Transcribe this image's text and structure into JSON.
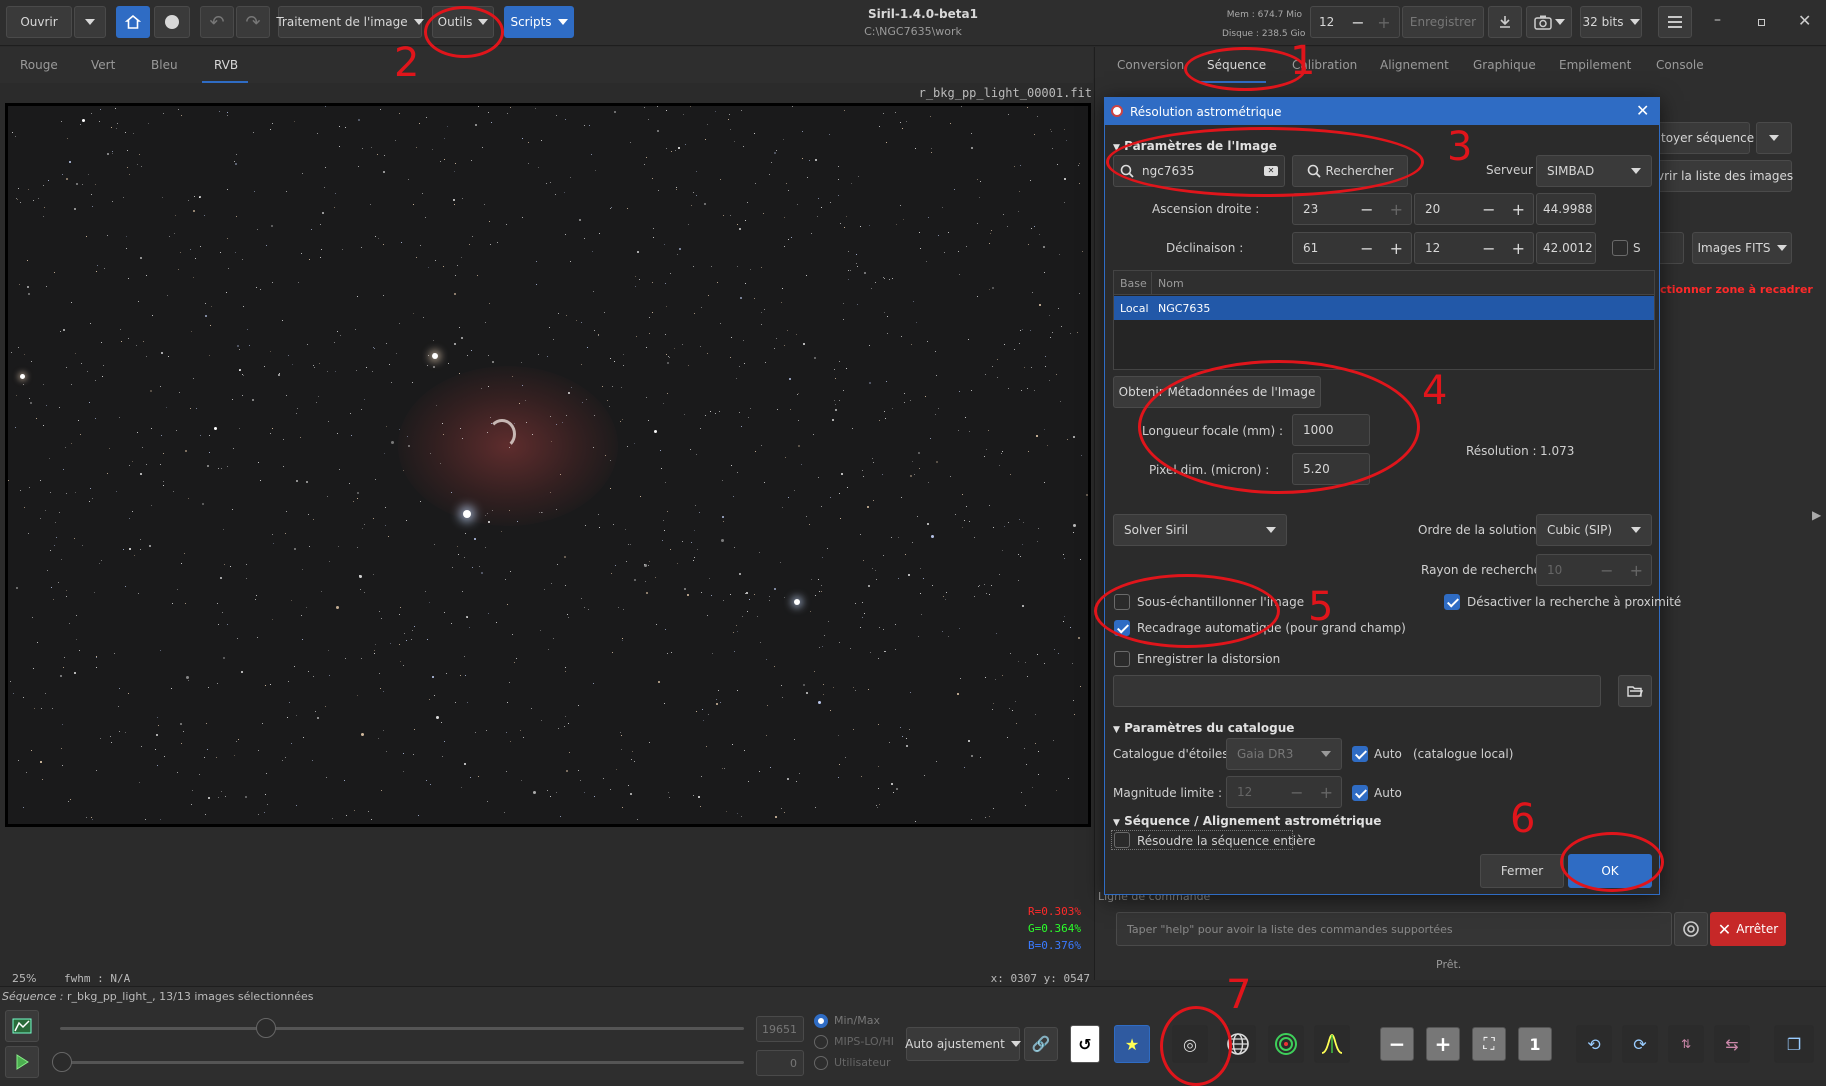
{
  "titlebar": {
    "open_label": "Ouvrir",
    "processing_menu": "Traitement de l'image",
    "tools_menu": "Outils",
    "scripts_menu": "Scripts",
    "app_title": "Siril-1.4.0-beta1",
    "work_dir": "C:\\NGC7635\\work",
    "mem": "Mem : 674.7 Mio",
    "disk": "Disque : 238.5 Gio",
    "threads": "12",
    "save_label": "Enregistrer",
    "bits_label": "32 bits"
  },
  "channel_tabs": [
    "Rouge",
    "Vert",
    "Bleu",
    "RVB"
  ],
  "image": {
    "filename": "r_bkg_pp_light_00001.fit",
    "zoom": "25%",
    "fwhm": "fwhm  :  N/A",
    "coords": "x: 0307  y: 0547",
    "r": "R=0.303%",
    "g": "G=0.364%",
    "b": "B=0.376%"
  },
  "right_tabs": [
    "Conversion",
    "Séquence",
    "Calibration",
    "Alignement",
    "Graphique",
    "Empilement",
    "Console"
  ],
  "right_panel": {
    "clean_seq": "toyer séquence",
    "open_list": "vrir la liste des images",
    "fits_images": "Images FITS",
    "crop_zone": "ctionner zone à recadrer",
    "cmd_label": "Ligne de commande",
    "cmd_placeholder": "Taper \"help\" pour avoir la liste des commandes supportées",
    "stop_label": "Arrêter",
    "ready": "Prêt."
  },
  "dialog": {
    "title": "Résolution astrométrique",
    "section_image": "Paramètres de l'Image",
    "search_value": "ngc7635",
    "search_button": "Rechercher",
    "server_label": "Serveur :",
    "server_value": "SIMBAD",
    "ra_label": "Ascension droite :",
    "ra_h": "23",
    "ra_m": "20",
    "ra_s": "44.9988",
    "dec_label": "Déclinaison :",
    "dec_d": "61",
    "dec_m": "12",
    "dec_s": "42.0012",
    "south_label": "S",
    "col_base": "Base",
    "col_name": "Nom",
    "row_base": "Local",
    "row_name": "NGC7635",
    "metadata_button": "Obtenir Métadonnées de l'Image",
    "focal_label": "Longueur focale (mm) :",
    "focal_value": "1000",
    "pixel_label": "Pixel dim. (micron) :",
    "pixel_value": "5.20",
    "resolution_label": "Résolution :",
    "resolution_value": "1.073",
    "solver_value": "Solver Siril",
    "order_label": "Ordre de la solution :",
    "order_value": "Cubic (SIP)",
    "radius_label": "Rayon de recherche :",
    "radius_value": "10",
    "downsample_label": "Sous-échantillonner l'image",
    "autocrop_label": "Recadrage automatique (pour grand champ)",
    "disable_near_label": "Désactiver la recherche à proximité",
    "save_distortion_label": "Enregistrer la distorsion",
    "section_catalog": "Paramètres du catalogue",
    "catalog_label": "Catalogue d'étoiles :",
    "catalog_value": "Gaia DR3",
    "auto_label": "Auto",
    "local_catalog": "(catalogue local)",
    "mag_label": "Magnitude limite :",
    "mag_value": "12",
    "section_seq": "Séquence / Alignement astrométrique",
    "solve_seq_label": "Résoudre la séquence entière",
    "close_button": "Fermer",
    "ok_button": "OK"
  },
  "bottom": {
    "sequence_label": "Séquence :",
    "sequence_value": " r_bkg_pp_light_, 13/13 images sélectionnées",
    "val_high": "19651",
    "val_low": "0",
    "radio_minmax": "Min/Max",
    "radio_mips": "MIPS-LO/HI",
    "radio_user": "Utilisateur",
    "stretch_value": "Auto ajustement"
  },
  "annotations": [
    "1",
    "2",
    "3",
    "4",
    "5",
    "6",
    "7"
  ]
}
